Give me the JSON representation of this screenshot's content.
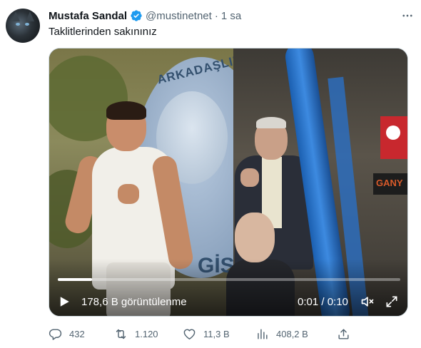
{
  "author": {
    "display_name": "Mustafa Sandal",
    "handle": "@mustinetnet",
    "separator": "·",
    "time_ago": "1 sa",
    "verified": true,
    "verified_color": "#1d9bf0"
  },
  "tweet": {
    "text": "Taklitlerinden sakınınız"
  },
  "media": {
    "left_scene_texts": {
      "arc": "ARKADAŞLIK",
      "bottom": "GİS"
    },
    "right_scene_texts": {
      "sign": "GANY"
    },
    "progress_fraction": 0.1,
    "view_count": "178,6 B görüntülenme",
    "time_display": "0:01 / 0:10",
    "icons": [
      "play-icon",
      "volume-icon",
      "expand-icon"
    ]
  },
  "actions": {
    "replies": "432",
    "retweets": "1.120",
    "likes": "11,3 B",
    "views": "408,2 B",
    "icons": [
      "reply-icon",
      "retweet-icon",
      "like-icon",
      "views-icon",
      "share-icon"
    ]
  },
  "colors": {
    "text_primary": "#0f1419",
    "text_secondary": "#536471",
    "border": "#cfd9de"
  }
}
